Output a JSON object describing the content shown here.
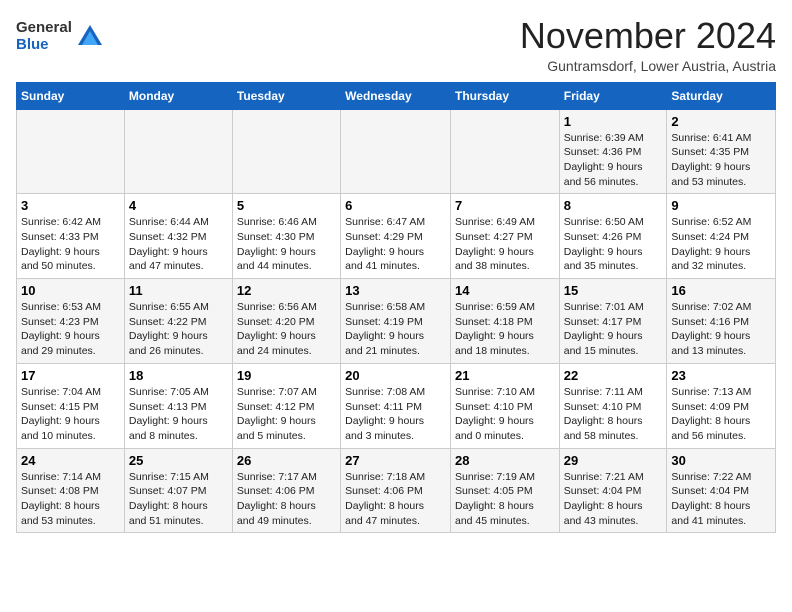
{
  "header": {
    "logo_general": "General",
    "logo_blue": "Blue",
    "month_title": "November 2024",
    "subtitle": "Guntramsdorf, Lower Austria, Austria"
  },
  "weekdays": [
    "Sunday",
    "Monday",
    "Tuesday",
    "Wednesday",
    "Thursday",
    "Friday",
    "Saturday"
  ],
  "weeks": [
    [
      {
        "day": "",
        "info": ""
      },
      {
        "day": "",
        "info": ""
      },
      {
        "day": "",
        "info": ""
      },
      {
        "day": "",
        "info": ""
      },
      {
        "day": "",
        "info": ""
      },
      {
        "day": "1",
        "info": "Sunrise: 6:39 AM\nSunset: 4:36 PM\nDaylight: 9 hours\nand 56 minutes."
      },
      {
        "day": "2",
        "info": "Sunrise: 6:41 AM\nSunset: 4:35 PM\nDaylight: 9 hours\nand 53 minutes."
      }
    ],
    [
      {
        "day": "3",
        "info": "Sunrise: 6:42 AM\nSunset: 4:33 PM\nDaylight: 9 hours\nand 50 minutes."
      },
      {
        "day": "4",
        "info": "Sunrise: 6:44 AM\nSunset: 4:32 PM\nDaylight: 9 hours\nand 47 minutes."
      },
      {
        "day": "5",
        "info": "Sunrise: 6:46 AM\nSunset: 4:30 PM\nDaylight: 9 hours\nand 44 minutes."
      },
      {
        "day": "6",
        "info": "Sunrise: 6:47 AM\nSunset: 4:29 PM\nDaylight: 9 hours\nand 41 minutes."
      },
      {
        "day": "7",
        "info": "Sunrise: 6:49 AM\nSunset: 4:27 PM\nDaylight: 9 hours\nand 38 minutes."
      },
      {
        "day": "8",
        "info": "Sunrise: 6:50 AM\nSunset: 4:26 PM\nDaylight: 9 hours\nand 35 minutes."
      },
      {
        "day": "9",
        "info": "Sunrise: 6:52 AM\nSunset: 4:24 PM\nDaylight: 9 hours\nand 32 minutes."
      }
    ],
    [
      {
        "day": "10",
        "info": "Sunrise: 6:53 AM\nSunset: 4:23 PM\nDaylight: 9 hours\nand 29 minutes."
      },
      {
        "day": "11",
        "info": "Sunrise: 6:55 AM\nSunset: 4:22 PM\nDaylight: 9 hours\nand 26 minutes."
      },
      {
        "day": "12",
        "info": "Sunrise: 6:56 AM\nSunset: 4:20 PM\nDaylight: 9 hours\nand 24 minutes."
      },
      {
        "day": "13",
        "info": "Sunrise: 6:58 AM\nSunset: 4:19 PM\nDaylight: 9 hours\nand 21 minutes."
      },
      {
        "day": "14",
        "info": "Sunrise: 6:59 AM\nSunset: 4:18 PM\nDaylight: 9 hours\nand 18 minutes."
      },
      {
        "day": "15",
        "info": "Sunrise: 7:01 AM\nSunset: 4:17 PM\nDaylight: 9 hours\nand 15 minutes."
      },
      {
        "day": "16",
        "info": "Sunrise: 7:02 AM\nSunset: 4:16 PM\nDaylight: 9 hours\nand 13 minutes."
      }
    ],
    [
      {
        "day": "17",
        "info": "Sunrise: 7:04 AM\nSunset: 4:15 PM\nDaylight: 9 hours\nand 10 minutes."
      },
      {
        "day": "18",
        "info": "Sunrise: 7:05 AM\nSunset: 4:13 PM\nDaylight: 9 hours\nand 8 minutes."
      },
      {
        "day": "19",
        "info": "Sunrise: 7:07 AM\nSunset: 4:12 PM\nDaylight: 9 hours\nand 5 minutes."
      },
      {
        "day": "20",
        "info": "Sunrise: 7:08 AM\nSunset: 4:11 PM\nDaylight: 9 hours\nand 3 minutes."
      },
      {
        "day": "21",
        "info": "Sunrise: 7:10 AM\nSunset: 4:10 PM\nDaylight: 9 hours\nand 0 minutes."
      },
      {
        "day": "22",
        "info": "Sunrise: 7:11 AM\nSunset: 4:10 PM\nDaylight: 8 hours\nand 58 minutes."
      },
      {
        "day": "23",
        "info": "Sunrise: 7:13 AM\nSunset: 4:09 PM\nDaylight: 8 hours\nand 56 minutes."
      }
    ],
    [
      {
        "day": "24",
        "info": "Sunrise: 7:14 AM\nSunset: 4:08 PM\nDaylight: 8 hours\nand 53 minutes."
      },
      {
        "day": "25",
        "info": "Sunrise: 7:15 AM\nSunset: 4:07 PM\nDaylight: 8 hours\nand 51 minutes."
      },
      {
        "day": "26",
        "info": "Sunrise: 7:17 AM\nSunset: 4:06 PM\nDaylight: 8 hours\nand 49 minutes."
      },
      {
        "day": "27",
        "info": "Sunrise: 7:18 AM\nSunset: 4:06 PM\nDaylight: 8 hours\nand 47 minutes."
      },
      {
        "day": "28",
        "info": "Sunrise: 7:19 AM\nSunset: 4:05 PM\nDaylight: 8 hours\nand 45 minutes."
      },
      {
        "day": "29",
        "info": "Sunrise: 7:21 AM\nSunset: 4:04 PM\nDaylight: 8 hours\nand 43 minutes."
      },
      {
        "day": "30",
        "info": "Sunrise: 7:22 AM\nSunset: 4:04 PM\nDaylight: 8 hours\nand 41 minutes."
      }
    ]
  ]
}
